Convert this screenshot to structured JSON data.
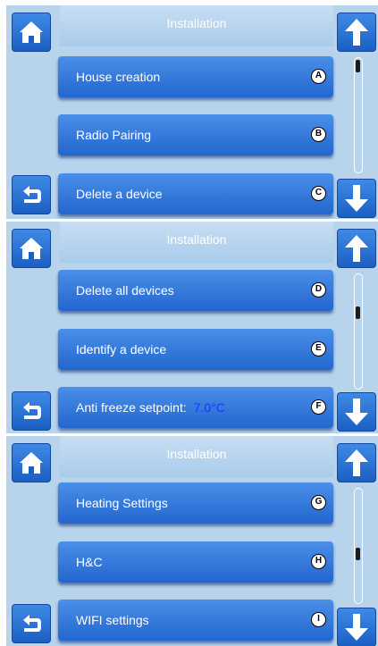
{
  "colors": {
    "panel": "#b8d3ec",
    "button": "#2f74d9",
    "badge_border": "#000000",
    "setpoint_value": "#1436ff"
  },
  "screens": [
    {
      "title": "Installation",
      "scroll_position": 0.0,
      "items": [
        {
          "label": "House creation",
          "badge": "A"
        },
        {
          "label": "Radio Pairing",
          "badge": "B"
        },
        {
          "label": "Delete a device",
          "badge": "C"
        }
      ]
    },
    {
      "title": "Installation",
      "scroll_position": 0.45,
      "items": [
        {
          "label": "Delete all devices",
          "badge": "D"
        },
        {
          "label": "Identify a device",
          "badge": "E"
        },
        {
          "label": "Anti freeze setpoint:",
          "value": "7.0°C",
          "badge": "F"
        }
      ]
    },
    {
      "title": "Installation",
      "scroll_position": 0.75,
      "items": [
        {
          "label": "Heating Settings",
          "badge": "G"
        },
        {
          "label": "H&C",
          "badge": "H"
        },
        {
          "label": "WIFI settings",
          "badge": "I"
        }
      ]
    }
  ],
  "icons": {
    "home": "home-icon",
    "back": "back-arrow-icon",
    "up": "up-arrow-icon",
    "down": "down-arrow-icon"
  }
}
